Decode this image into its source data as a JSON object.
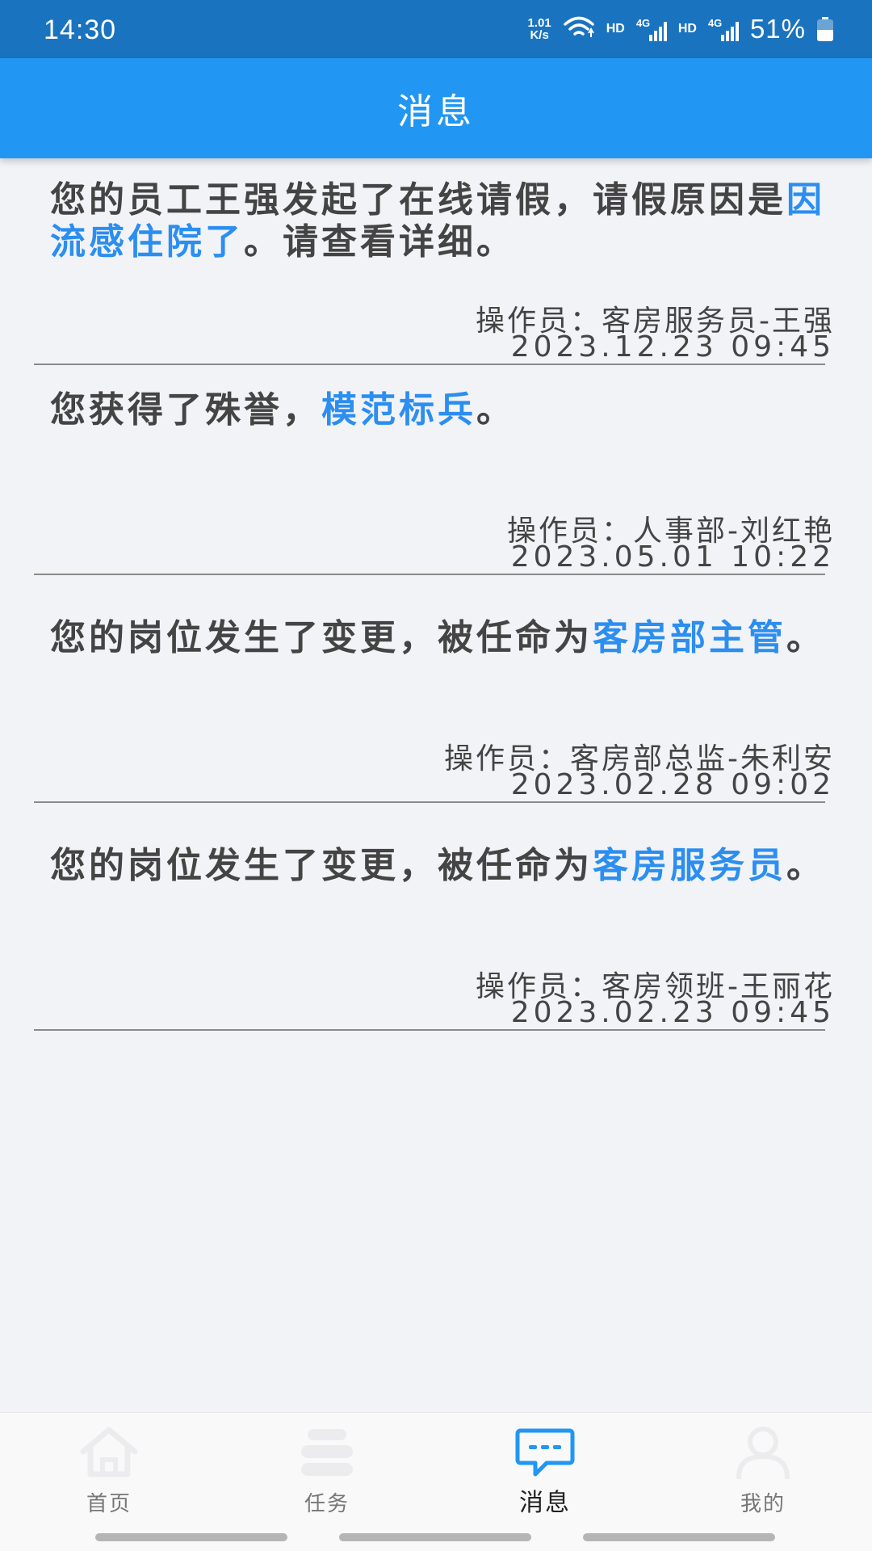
{
  "status_bar": {
    "time": "14:30",
    "net_speed_value": "1.01",
    "net_speed_unit": "K/s",
    "hd_label_1": "HD",
    "hd_label_2": "HD",
    "signal_label_1": "4G",
    "signal_label_2": "4G",
    "battery_percent": "51%",
    "battery_level": 0.51,
    "icons": [
      "wifi-icon",
      "signal-icon",
      "battery-icon"
    ]
  },
  "header": {
    "title": "消息"
  },
  "messages": [
    {
      "text_before": "您的员工王强发起了在线请假，请假原因是",
      "highlight": "因流感住院了",
      "text_after": "。请查看详细。",
      "operator": "操作员：客房服务员-王强",
      "time": "2023.12.23 09:45"
    },
    {
      "text_before": "您获得了殊誉，",
      "highlight": "模范标兵",
      "text_after": "。",
      "operator": "操作员：人事部-刘红艳",
      "time": "2023.05.01 10:22"
    },
    {
      "text_before": "您的岗位发生了变更，被任命为",
      "highlight": "客房部主管",
      "text_after": "。",
      "operator": "操作员：客房部总监-朱利安",
      "time": "2023.02.28 09:02"
    },
    {
      "text_before": "您的岗位发生了变更，被任命为",
      "highlight": "客房服务员",
      "text_after": "。",
      "operator": "操作员：客房领班-王丽花",
      "time": "2023.02.23 09:45"
    }
  ],
  "nav": {
    "items": [
      {
        "label": "首页",
        "icon": "home-icon"
      },
      {
        "label": "任务",
        "icon": "task-list-icon"
      },
      {
        "label": "消息",
        "icon": "message-icon",
        "active": true
      },
      {
        "label": "我的",
        "icon": "user-icon"
      }
    ]
  },
  "colors": {
    "status_bar": "#1a73bf",
    "header": "#2196f3",
    "highlight": "#2b8ef0",
    "background": "#f2f3f7"
  }
}
